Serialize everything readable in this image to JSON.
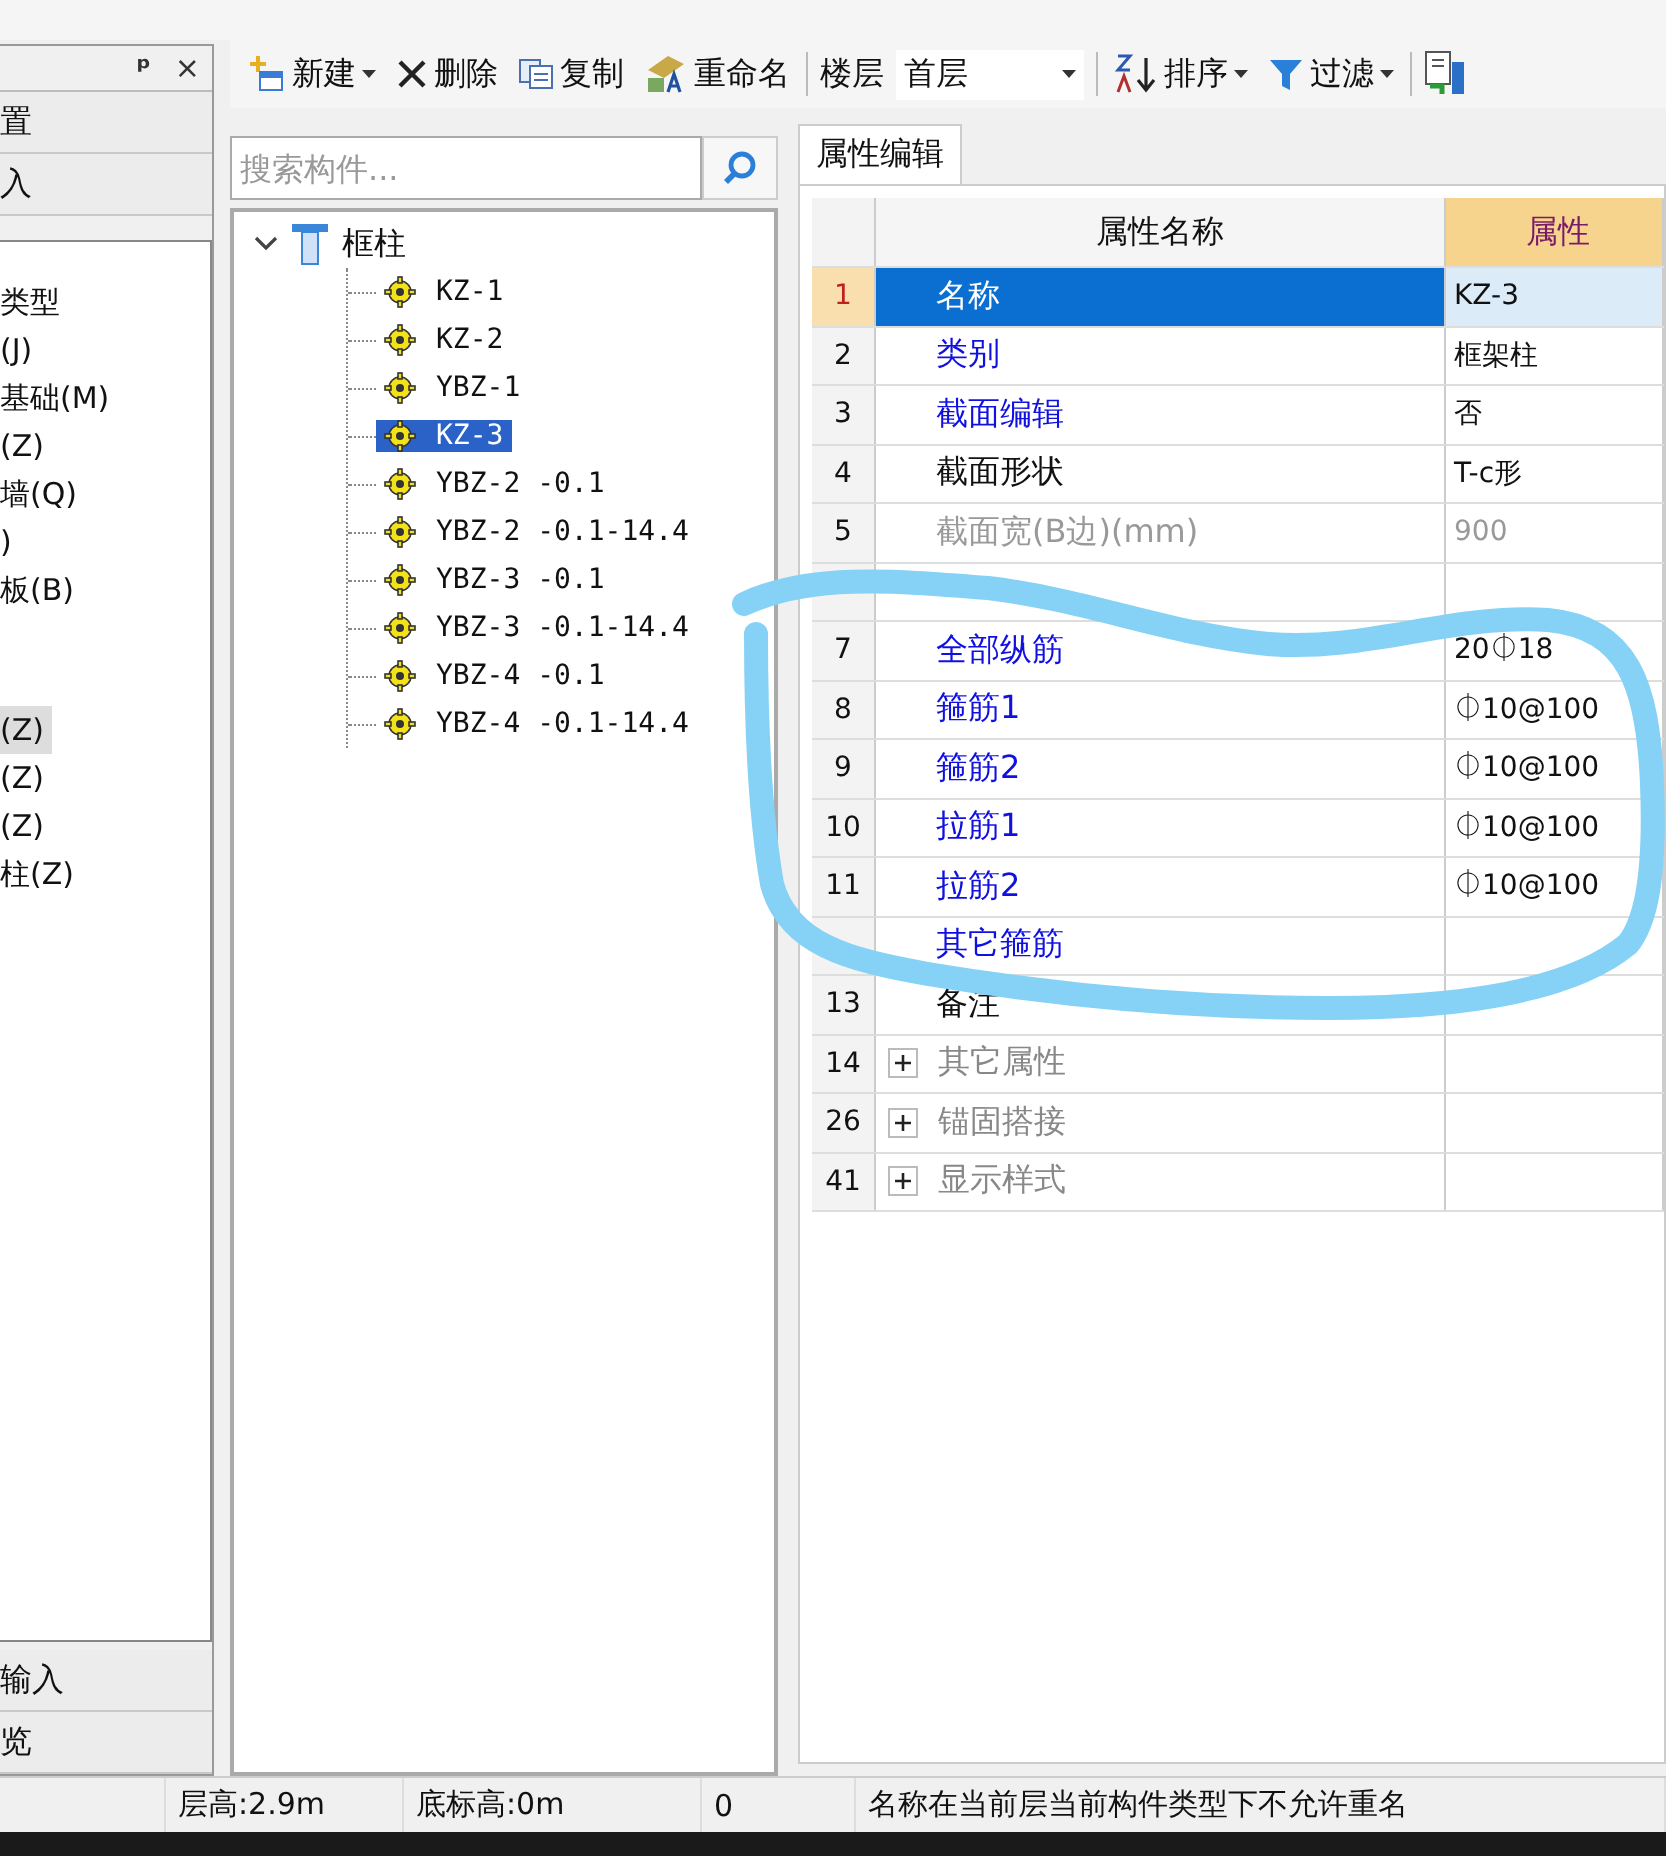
{
  "left_panel": {
    "header_buttons": [
      "ᵖ",
      "×"
    ],
    "tabs": [
      {
        "label": "置",
        "selected": false
      },
      {
        "label": "入",
        "selected": false
      }
    ],
    "groups": [
      [
        {
          "label": "类型",
          "selected": false
        },
        {
          "label": "(J)",
          "selected": false
        },
        {
          "label": "基础(M)",
          "selected": false
        },
        {
          "label": "(Z)",
          "selected": false
        },
        {
          "label": "墙(Q)",
          "selected": false
        },
        {
          "label": ")",
          "selected": false
        },
        {
          "label": "板(B)",
          "selected": false
        }
      ],
      [
        {
          "label": "(Z)",
          "selected": true
        },
        {
          "label": "(Z)",
          "selected": false
        },
        {
          "label": "(Z)",
          "selected": false
        },
        {
          "label": "柱(Z)",
          "selected": false
        }
      ]
    ],
    "bottom_tabs": [
      "输入",
      "览"
    ]
  },
  "toolbar": [
    {
      "kind": "button",
      "label": "新建",
      "dropdown": true
    },
    {
      "kind": "button",
      "label": "删除",
      "dropdown": false
    },
    {
      "kind": "button",
      "label": "复制",
      "dropdown": false
    },
    {
      "kind": "button",
      "label": "重命名",
      "dropdown": false
    },
    {
      "kind": "label",
      "label": "楼层"
    },
    {
      "kind": "select",
      "label": "首层",
      "dropdown": true
    },
    {
      "kind": "button",
      "label": "排序",
      "dropdown": true
    },
    {
      "kind": "button",
      "label": "过滤",
      "dropdown": true
    }
  ],
  "search": {
    "placeholder": "搜索构件..."
  },
  "tree": {
    "label": "框柱",
    "expanded": true,
    "children": [
      {
        "label": "KZ-1",
        "selected": false
      },
      {
        "label": "KZ-2",
        "selected": false
      },
      {
        "label": "YBZ-1",
        "selected": false
      },
      {
        "label": "KZ-3",
        "selected": true
      },
      {
        "label": "YBZ-2 -0.1",
        "selected": false
      },
      {
        "label": "YBZ-2 -0.1-14.4",
        "selected": false
      },
      {
        "label": "YBZ-3 -0.1",
        "selected": false
      },
      {
        "label": "YBZ-3 -0.1-14.4",
        "selected": false
      },
      {
        "label": "YBZ-4 -0.1",
        "selected": false
      },
      {
        "label": "YBZ-4 -0.1-14.4",
        "selected": false
      }
    ]
  },
  "tabs": [
    {
      "label": "属性编辑",
      "selected": true
    }
  ],
  "table": {
    "columns": [
      "属性名称",
      "属性"
    ],
    "rows": [
      {
        "num": "1",
        "name": "名称",
        "value": "KZ-3",
        "kind": "link",
        "selected": true
      },
      {
        "num": "2",
        "name": "类别",
        "value": "框架柱",
        "kind": "link",
        "selected": false
      },
      {
        "num": "3",
        "name": "截面编辑",
        "value": "否",
        "kind": "link",
        "selected": false
      },
      {
        "num": "4",
        "name": "截面形状",
        "value": "T-c形",
        "kind": "plain",
        "selected": false
      },
      {
        "num": "5",
        "name": "截面宽(B边)(mm)",
        "value": "900",
        "kind": "disabled",
        "selected": false
      },
      {
        "kind": "disabled",
        "selected": false
      },
      {
        "num": "7",
        "name": "全部纵筋",
        "value": "20⏀18",
        "kind": "link",
        "selected": false
      },
      {
        "num": "8",
        "name": "箍筋1",
        "value": "⏀10@100",
        "kind": "link",
        "selected": false
      },
      {
        "num": "9",
        "name": "箍筋2",
        "value": "⏀10@100",
        "kind": "link",
        "selected": false
      },
      {
        "num": "10",
        "name": "拉筋1",
        "value": "⏀10@100",
        "kind": "link",
        "selected": false
      },
      {
        "num": "11",
        "name": "拉筋2",
        "value": "⏀10@100",
        "kind": "link",
        "selected": false
      },
      {
        "name": "其它箍筋",
        "kind": "link",
        "selected": false
      },
      {
        "num": "13",
        "name": "备注",
        "kind": "plain",
        "selected": false
      },
      {
        "num": "14",
        "name": "其它属性",
        "kind": "group",
        "selected": false
      },
      {
        "num": "26",
        "name": "锚固搭接",
        "kind": "group",
        "selected": false
      },
      {
        "num": "41",
        "name": "显示样式",
        "kind": "group",
        "selected": false
      }
    ]
  },
  "status_bar": [
    "层高:2.9m",
    "底标高:0m",
    "0",
    "名称在当前层当前构件类型下不允许重名"
  ]
}
